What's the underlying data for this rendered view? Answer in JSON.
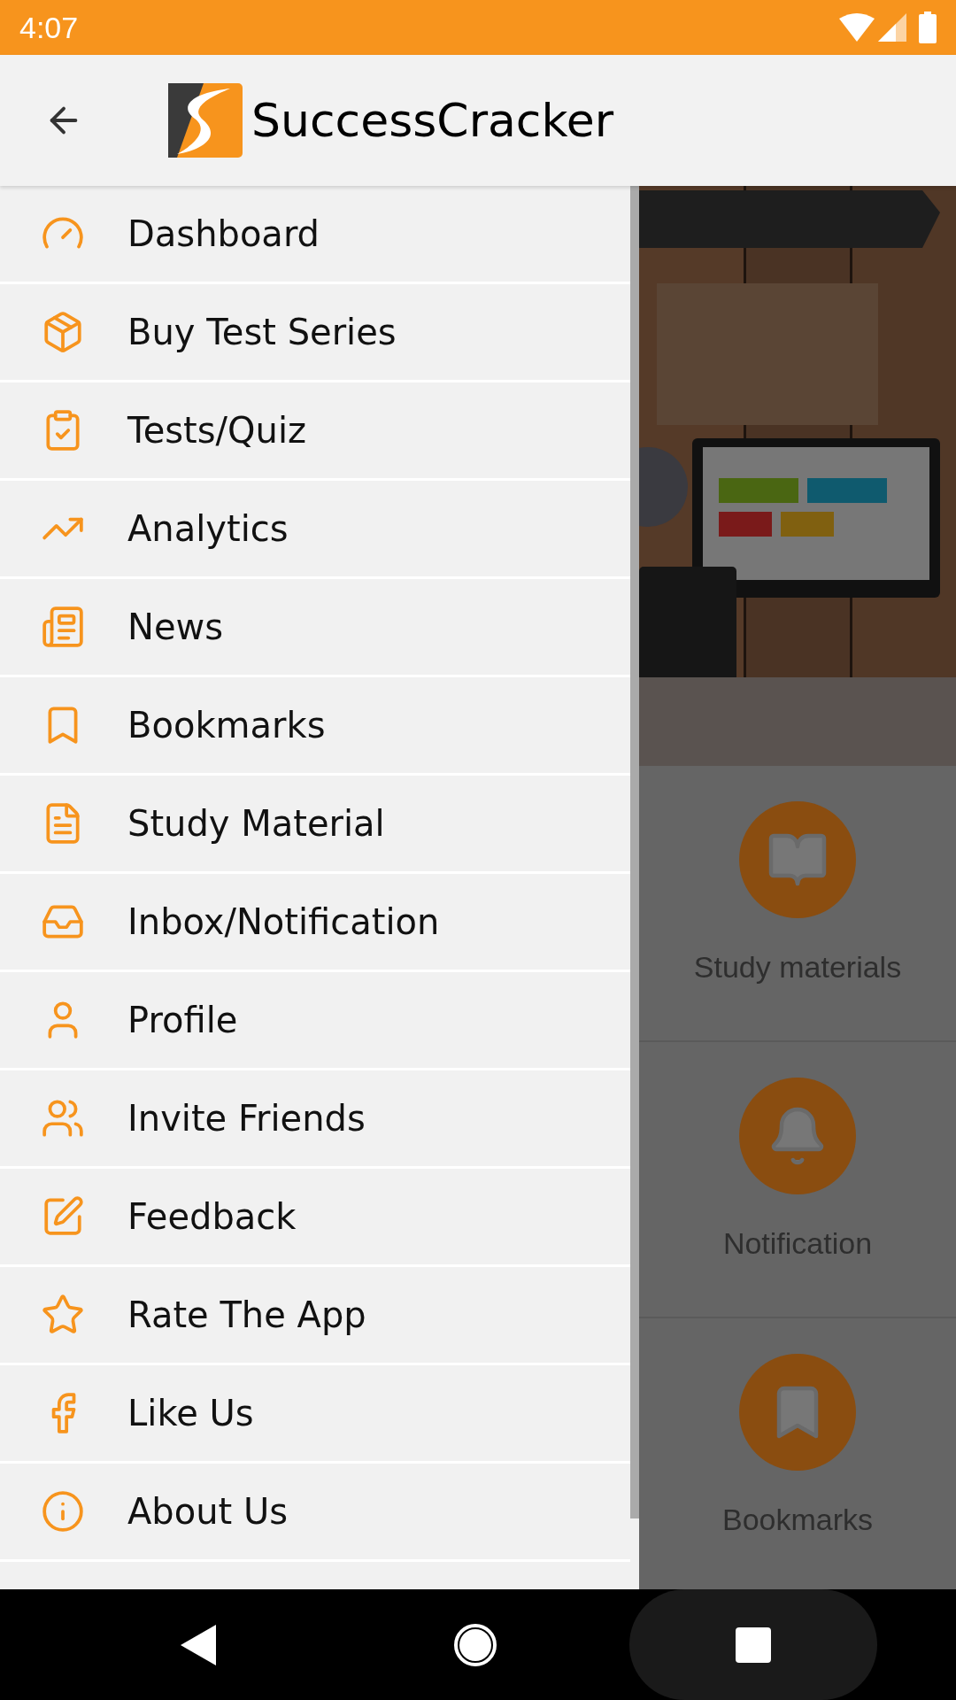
{
  "status_bar": {
    "time": "4:07"
  },
  "app_bar": {
    "title": "SuccessCracker"
  },
  "drawer": {
    "items": [
      {
        "label": "Dashboard"
      },
      {
        "label": "Buy Test Series"
      },
      {
        "label": "Tests/Quiz"
      },
      {
        "label": "Analytics"
      },
      {
        "label": "News"
      },
      {
        "label": "Bookmarks"
      },
      {
        "label": "Study Material"
      },
      {
        "label": "Inbox/Notification"
      },
      {
        "label": "Profile"
      },
      {
        "label": "Invite Friends"
      },
      {
        "label": "Feedback"
      },
      {
        "label": "Rate The App"
      },
      {
        "label": "Like Us"
      },
      {
        "label": "About Us"
      }
    ]
  },
  "home": {
    "tiles": [
      {
        "label": "Study materials"
      },
      {
        "label": "Notification"
      },
      {
        "label": "Bookmarks"
      }
    ]
  }
}
